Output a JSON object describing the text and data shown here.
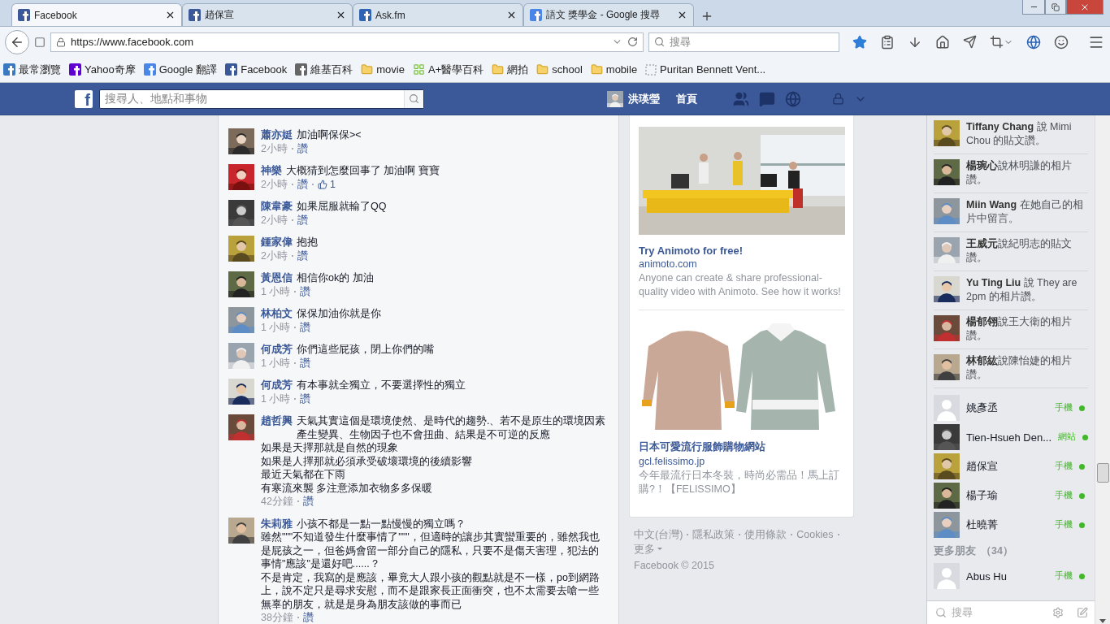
{
  "browser": {
    "tabs": [
      {
        "title": "Facebook",
        "selected": true,
        "kind": "facebook"
      },
      {
        "title": "趙保宣",
        "selected": false,
        "kind": "facebook"
      },
      {
        "title": "Ask.fm",
        "selected": false,
        "kind": "askfm"
      },
      {
        "title": "語文 獎學金 - Google 搜尋",
        "selected": false,
        "kind": "google"
      }
    ],
    "address": {
      "value": "https://www.facebook.com"
    },
    "search": {
      "placeholder": "搜尋"
    },
    "bookmarks": [
      {
        "label": "最常瀏覽",
        "kind": "page"
      },
      {
        "label": "Yahoo奇摩",
        "kind": "yahoo"
      },
      {
        "label": "Google 翻譯",
        "kind": "translate"
      },
      {
        "label": "Facebook",
        "kind": "facebook"
      },
      {
        "label": "維基百科",
        "kind": "wiki"
      },
      {
        "label": "movie",
        "kind": "folder"
      },
      {
        "label": "A+醫學百科",
        "kind": "grid"
      },
      {
        "label": "網拍",
        "kind": "folder"
      },
      {
        "label": "school",
        "kind": "folder"
      },
      {
        "label": "mobile",
        "kind": "folder"
      },
      {
        "label": "Puritan Bennett Vent...",
        "kind": "blank"
      }
    ]
  },
  "header": {
    "logo": "f",
    "search": {
      "placeholder": "搜尋人、地點和事物"
    },
    "profile": {
      "name": "洪瑛瑩"
    },
    "home": "首頁"
  },
  "comments": [
    {
      "name": "蕭亦娗",
      "lines": [
        "加油啊保保><"
      ],
      "time": "2小時",
      "like": "讚"
    },
    {
      "name": "神樂",
      "lines": [
        "大概猜到怎麼回事了 加油啊 寶寶"
      ],
      "time": "2小時",
      "like": "讚",
      "likes": "1"
    },
    {
      "name": "陳韋豪",
      "lines": [
        "如果屈服就輸了QQ"
      ],
      "time": "2小時",
      "like": "讚"
    },
    {
      "name": "鍾家偉",
      "lines": [
        "抱抱"
      ],
      "time": "2小時",
      "like": "讚"
    },
    {
      "name": "黃恩信",
      "lines": [
        "相信你ok的 加油"
      ],
      "time": "1 小時",
      "like": "讚"
    },
    {
      "name": "林柏文",
      "lines": [
        "保保加油你就是你"
      ],
      "time": "1 小時",
      "like": "讚"
    },
    {
      "name": "何成芳",
      "lines": [
        "你們這些屁孩，閉上你們的嘴"
      ],
      "time": "1 小時",
      "like": "讚"
    },
    {
      "name": "何成芳",
      "lines": [
        "有本事就全獨立，不要選擇性的獨立"
      ],
      "time": "1 小時",
      "like": "讚"
    },
    {
      "name": "趙哲興",
      "lines": [
        "天氣其實這個是環境使然、是時代的趨勢.、若不是原生的環境因素產生變異、生物因子也不會扭曲、結果是不可逆的反應",
        "如果是天擇那就是自然的現象",
        "如果是人擇那就必須承受破壞環境的後續影響",
        "最近天氣都在下雨",
        "有寒流來襲 多注意添加衣物多多保暖"
      ],
      "time": "42分鐘",
      "like": "讚"
    },
    {
      "name": "朱莉雅",
      "lines": [
        "小孩不都是一點一點慢慢的獨立嗎？",
        "雖然\"\"\"不知道發生什麼事情了\"\"\"，但適時的讓步其實蠻重要的，雖然我也是屁孩之一，但爸媽會留一部分自己的隱私，只要不是傷天害理，犯法的事情\"應該\"是還好吧......？",
        "不是肯定，我寫的是應該，畢竟大人跟小孩的觀點就是不一樣，po到網路上，說不定只是尋求安慰，而不是跟家長正面衝突，也不太需要去嗆一些無辜的朋友，就是是身為朋友該做的事而已"
      ],
      "time": "38分鐘",
      "like": "讚"
    }
  ],
  "ads": [
    {
      "kind": "office",
      "title": "Try Animoto for free!",
      "domain": "animoto.com",
      "description": "Anyone can create & share professional-quality video with Animoto. See how it works!"
    },
    {
      "kind": "clothes",
      "title": "日本可愛流行服飾購物網站",
      "domain": "gcl.felissimo.jp",
      "description": "今年最流行日本冬裝，時尚必需品！馬上訂購?！【FELISSIMO】"
    }
  ],
  "footer": {
    "links": [
      "中文(台灣)",
      "隱私政策",
      "使用條款",
      "Cookies"
    ],
    "more": "更多",
    "copyright": "Facebook © 2015"
  },
  "ticker": [
    {
      "text": "**Tiffany Chang** 說 Mimi Chou 的貼文讚。"
    },
    {
      "text": "**楊琬心**說林明謙的相片讚。"
    },
    {
      "text": "**Miin Wang** 在她自己的相片中留言。"
    },
    {
      "text": "**王威元**說紀明志的貼文讚。"
    },
    {
      "text": "**Yu Ting Liu** 說 They are 2pm 的相片讚。"
    },
    {
      "text": "**楊郁翎**說王大衛的相片讚。"
    },
    {
      "text": "**林郁紘**說陳怡婕的相片讚。"
    }
  ],
  "contacts": [
    {
      "name": "姚彥丞",
      "status": "手機",
      "color": "#42b72a",
      "kind": "silhouette"
    },
    {
      "name": "Tien-Hsueh Den...",
      "status": "網站",
      "color": "#42b72a"
    },
    {
      "name": "趙保宣",
      "status": "手機",
      "color": "#42b72a"
    },
    {
      "name": "楊子瑜",
      "status": "手機",
      "color": "#42b72a"
    },
    {
      "name": "杜曉菁",
      "status": "手機",
      "color": "#42b72a"
    }
  ],
  "more_friends": {
    "label": "更多朋友",
    "count": "（34）"
  },
  "more_contacts": [
    {
      "name": "Abus Hu",
      "status": "手機",
      "color": "#42b72a",
      "kind": "silhouette"
    }
  ],
  "chat_search": {
    "placeholder": "搜尋"
  }
}
